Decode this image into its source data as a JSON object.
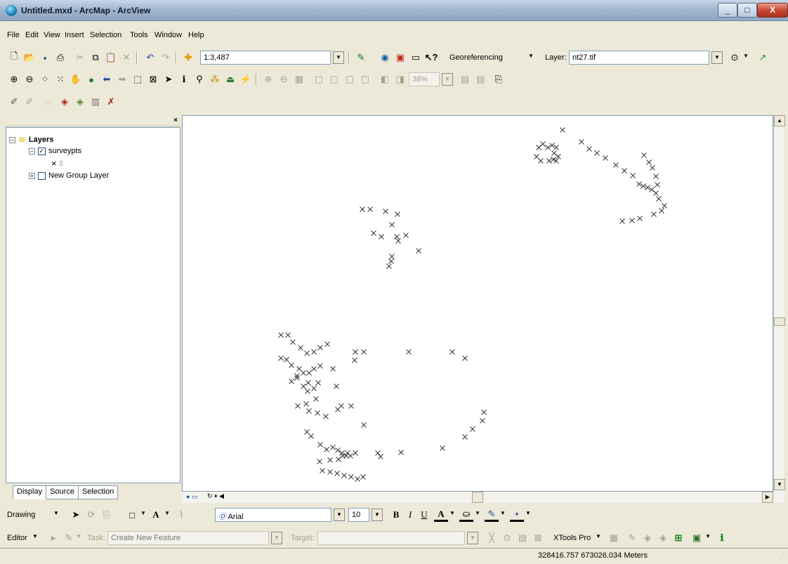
{
  "window": {
    "title": "Untitled.mxd - ArcMap - ArcView"
  },
  "menu": [
    "File",
    "Edit",
    "View",
    "Insert",
    "Selection",
    "Tools",
    "Window",
    "Help"
  ],
  "standard_toolbar": {
    "scale": "1:3,487",
    "georeferencing_label": "Georeferencing",
    "layer_label": "Layer:",
    "layer_value": "nt27.tif"
  },
  "tools_toolbar": {
    "zoom_percent": "38%"
  },
  "toc": {
    "root_label": "Layers",
    "layers": [
      {
        "label": "surveypts",
        "checked": true
      },
      {
        "label": "New Group Layer",
        "checked": false
      }
    ],
    "tabs": [
      "Display",
      "Source",
      "Selection"
    ]
  },
  "draw_toolbar": {
    "drawing_label": "Drawing",
    "font": "Arial",
    "font_size": "10"
  },
  "editor_toolbar": {
    "editor_label": "Editor",
    "task_label": "Task:",
    "task_value": "Create New Feature",
    "target_label": "Target:",
    "xtools_label": "XTools Pro"
  },
  "status": {
    "coords": "328416.757 673026.034 Meters"
  },
  "map_points_glyph": "×"
}
